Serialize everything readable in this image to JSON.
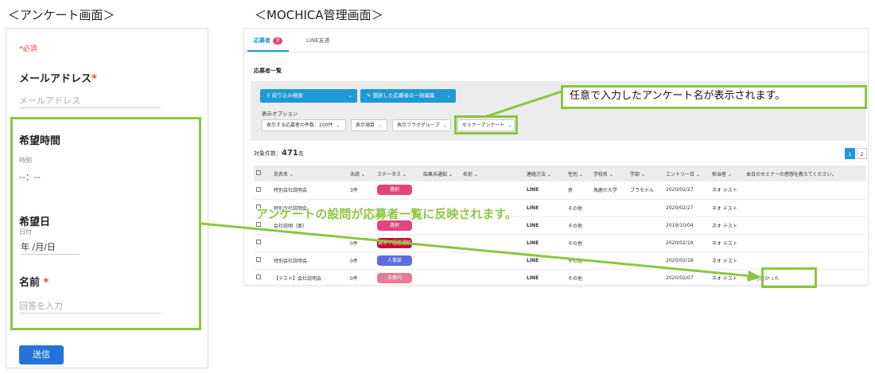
{
  "captions": {
    "survey": "＜アンケート画面＞",
    "admin": "＜MOCHICA管理画面＞"
  },
  "survey": {
    "required_note": "*必須",
    "email_label": "メールアドレス",
    "required_mark": "*",
    "email_placeholder": "メールアドレス",
    "time_label": "希望時間",
    "time_sub": "時刻",
    "time_value": "--：--",
    "date_label": "希望日",
    "date_sub": "日付",
    "date_value": "年 /月/日",
    "name_label": "名前",
    "name_placeholder": "回答を入力",
    "submit_label": "送信"
  },
  "admin": {
    "tabs": [
      {
        "label": "応募者",
        "badge": "7"
      },
      {
        "label": "LINE友達"
      }
    ],
    "section_title": "応募者一覧",
    "search_button": "絞り込み検索",
    "bulk_button": "選択した応募者の一括編集",
    "display_options_label": "表示オプション",
    "dropdowns": [
      "表示する応募者の件数：200件",
      "表示項目",
      "表示フラググループ",
      "セミナーアンケート"
    ],
    "count_label": "対象件数：",
    "count_value": "471",
    "count_unit": "名",
    "pages": [
      "1",
      "2"
    ],
    "columns": [
      "氏名名",
      "未読",
      "ステータス",
      "結果未通知",
      "名前",
      "連絡方法",
      "性別",
      "学校名",
      "学部",
      "エントリー日",
      "担当者",
      "本日のセミナーの感想を教えてください。"
    ],
    "rows": [
      {
        "name": "特別会社説明会",
        "unread": "3件",
        "status": "選択",
        "status_color": "#e0467d",
        "contact": "LINE",
        "gender": "男",
        "school": "馬鹿だ大学",
        "faculty": "ブラモデル",
        "entry": "2020/02/27",
        "staff": "ネオ テスト",
        "answer": ""
      },
      {
        "name": "特別会社説明会",
        "unread": "",
        "status": "",
        "status_color": "#e0467d",
        "contact": "LINE",
        "gender": "その他",
        "school": "",
        "faculty": "",
        "entry": "2020/02/27",
        "staff": "ネオ テスト",
        "answer": ""
      },
      {
        "name": "会社説明（面）",
        "unread": "",
        "status": "選択",
        "status_color": "#e0467d",
        "contact": "LINE",
        "gender": "その他",
        "school": "",
        "faculty": "",
        "entry": "2019/10/04",
        "staff": "ネオ テスト",
        "answer": ""
      },
      {
        "name": "",
        "unread": "0件",
        "status": "選考不通過通知",
        "status_color": "#c8102e",
        "contact": "LINE",
        "gender": "その他",
        "school": "",
        "faculty": "",
        "entry": "2020/02/19",
        "staff": "ネオ テスト",
        "answer": ""
      },
      {
        "name": "特別会社説明会",
        "unread": "0件",
        "status": "人事部",
        "status_color": "#5b6ee1",
        "contact": "LINE",
        "gender": "その他",
        "school": "",
        "faculty": "",
        "entry": "2020/02/18",
        "staff": "ネオ テスト",
        "answer": ""
      },
      {
        "name": "【テスト】会社説明会",
        "unread": "0件",
        "status": "未案内",
        "status_color": "#e87a9a",
        "contact": "LINE",
        "gender": "その他",
        "school": "",
        "faculty": "",
        "entry": "2020/02/07",
        "staff": "ネオ テスト",
        "answer": "とても良かった"
      }
    ]
  },
  "annotations": {
    "callout": "任意で入力したアンケート名が表示されます。",
    "banner": "アンケートの設問が応募者一覧に反映されます。",
    "color": "#8cc63f"
  }
}
